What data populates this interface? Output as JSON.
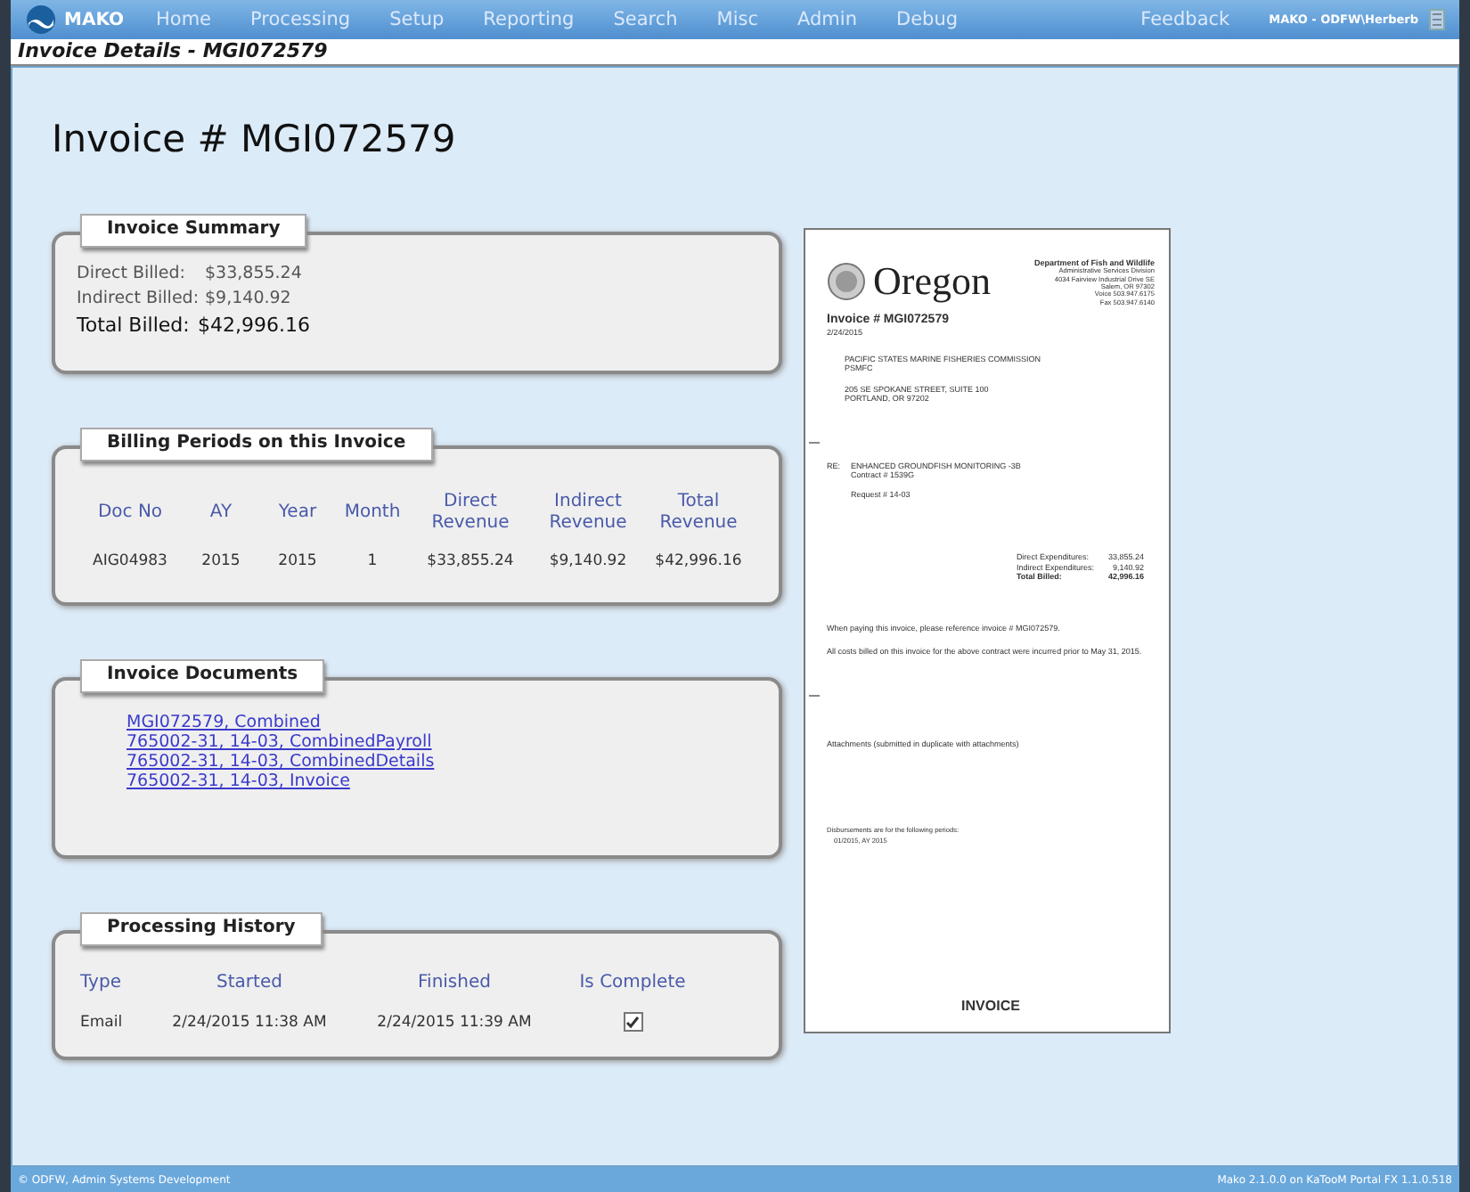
{
  "nav": {
    "logo": "MAKO",
    "items": [
      "Home",
      "Processing",
      "Setup",
      "Reporting",
      "Search",
      "Misc",
      "Admin",
      "Debug"
    ],
    "feedback": "Feedback",
    "user": "MAKO - ODFW\\Herberb"
  },
  "page_bar": "Invoice Details - MGI072579",
  "heading": "Invoice # MGI072579",
  "summary": {
    "title": "Invoice Summary",
    "rows": [
      {
        "label": "Direct Billed:",
        "value": "$33,855.24",
        "total": false
      },
      {
        "label": "Indirect Billed:",
        "value": "$9,140.92",
        "total": false
      },
      {
        "label": "Total Billed:",
        "value": "$42,996.16",
        "total": true
      }
    ]
  },
  "billing": {
    "title": "Billing Periods on this Invoice",
    "columns": [
      "Doc No",
      "AY",
      "Year",
      "Month",
      "Direct Revenue",
      "Indirect Revenue",
      "Total Revenue"
    ],
    "rows": [
      [
        "AIG04983",
        "2015",
        "2015",
        "1",
        "$33,855.24",
        "$9,140.92",
        "$42,996.16"
      ]
    ]
  },
  "documents": {
    "title": "Invoice Documents",
    "links": [
      "MGI072579, Combined",
      "765002-31, 14-03, CombinedPayroll",
      "765002-31, 14-03, CombinedDetails",
      "765002-31, 14-03, Invoice"
    ]
  },
  "history": {
    "title": "Processing History",
    "columns": [
      "Type",
      "Started",
      "Finished",
      "Is Complete"
    ],
    "rows": [
      {
        "type": "Email",
        "started": "2/24/2015 11:38 AM",
        "finished": "2/24/2015 11:39 AM",
        "complete": true
      }
    ]
  },
  "preview": {
    "brand": "Oregon",
    "agency": [
      "Department of Fish and Wildlife",
      "Administrative Services Division",
      "4034 Fairview Industrial Drive SE",
      "Salem, OR 97302",
      "Voice 503.947.6175",
      "Fax 503.947.6140"
    ],
    "invoice_no": "Invoice # MGI072579",
    "date": "2/24/2015",
    "address": [
      "PACIFIC STATES MARINE FISHERIES COMMISSION",
      "PSMFC"
    ],
    "street": [
      "205 SE SPOKANE STREET, SUITE 100",
      "PORTLAND, OR 97202"
    ],
    "re_label": "RE:",
    "re": [
      "ENHANCED GROUNDFISH MONITORING -3B",
      "Contract # 1539G"
    ],
    "request": "Request # 14-03",
    "totals": [
      {
        "label": "Direct Expenditures:",
        "value": "33,855.24",
        "total": false
      },
      {
        "label": "Indirect Expenditures:",
        "value": "9,140.92",
        "total": false
      },
      {
        "label": "Total Billed:",
        "value": "42,996.16",
        "total": true
      }
    ],
    "notes": [
      "When paying this invoice, please reference invoice # MGI072579.",
      "All costs billed on this invoice for the above contract were incurred prior to May 31, 2015."
    ],
    "attachments": "Attachments (submitted in duplicate with attachments)",
    "periods": [
      "Disbursements are for the following periods:",
      "01/2015, AY 2015"
    ],
    "footer": "INVOICE"
  },
  "status_bar": {
    "left": "© ODFW, Admin Systems Development",
    "right": "Mako 2.1.0.0 on KaTooM Portal FX 1.1.0.518"
  }
}
